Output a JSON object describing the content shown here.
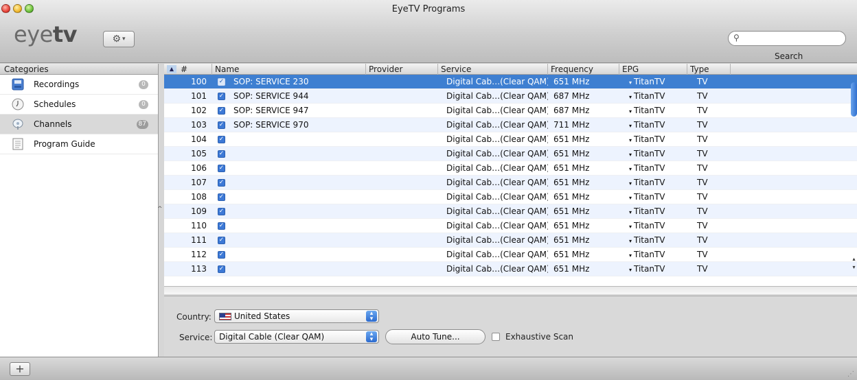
{
  "window": {
    "title": "EyeTV Programs"
  },
  "toolbar": {
    "logo_light": "eye",
    "logo_bold": "tv",
    "action_icon": "gear-icon",
    "search_placeholder": "",
    "search_label": "Search"
  },
  "sidebar": {
    "header": "Categories",
    "items": [
      {
        "label": "Recordings",
        "count": "0",
        "icon": "recordings-icon"
      },
      {
        "label": "Schedules",
        "count": "0",
        "icon": "clock-icon"
      },
      {
        "label": "Channels",
        "count": "87",
        "icon": "satellite-dish-icon"
      },
      {
        "label": "Program Guide",
        "count": "",
        "icon": "program-guide-icon"
      }
    ]
  },
  "table": {
    "columns": {
      "num": "#",
      "name": "Name",
      "provider": "Provider",
      "service": "Service",
      "frequency": "Frequency",
      "epg": "EPG",
      "type": "Type"
    },
    "rows": [
      {
        "num": "100",
        "name": "SOP: SERVICE 230",
        "provider": "",
        "service": "Digital Cab…(Clear QAM)",
        "frequency": "651 MHz",
        "epg": "TitanTV",
        "type": "TV"
      },
      {
        "num": "101",
        "name": "SOP: SERVICE 944",
        "provider": "",
        "service": "Digital Cab…(Clear QAM)",
        "frequency": "687 MHz",
        "epg": "TitanTV",
        "type": "TV"
      },
      {
        "num": "102",
        "name": "SOP: SERVICE 947",
        "provider": "",
        "service": "Digital Cab…(Clear QAM)",
        "frequency": "687 MHz",
        "epg": "TitanTV",
        "type": "TV"
      },
      {
        "num": "103",
        "name": "SOP: SERVICE 970",
        "provider": "",
        "service": "Digital Cab…(Clear QAM)",
        "frequency": "711 MHz",
        "epg": "TitanTV",
        "type": "TV"
      },
      {
        "num": "104",
        "name": "",
        "provider": "",
        "service": "Digital Cab…(Clear QAM)",
        "frequency": "651 MHz",
        "epg": "TitanTV",
        "type": "TV"
      },
      {
        "num": "105",
        "name": "",
        "provider": "",
        "service": "Digital Cab…(Clear QAM)",
        "frequency": "651 MHz",
        "epg": "TitanTV",
        "type": "TV"
      },
      {
        "num": "106",
        "name": "",
        "provider": "",
        "service": "Digital Cab…(Clear QAM)",
        "frequency": "651 MHz",
        "epg": "TitanTV",
        "type": "TV"
      },
      {
        "num": "107",
        "name": "",
        "provider": "",
        "service": "Digital Cab…(Clear QAM)",
        "frequency": "651 MHz",
        "epg": "TitanTV",
        "type": "TV"
      },
      {
        "num": "108",
        "name": "",
        "provider": "",
        "service": "Digital Cab…(Clear QAM)",
        "frequency": "651 MHz",
        "epg": "TitanTV",
        "type": "TV"
      },
      {
        "num": "109",
        "name": "",
        "provider": "",
        "service": "Digital Cab…(Clear QAM)",
        "frequency": "651 MHz",
        "epg": "TitanTV",
        "type": "TV"
      },
      {
        "num": "110",
        "name": "",
        "provider": "",
        "service": "Digital Cab…(Clear QAM)",
        "frequency": "651 MHz",
        "epg": "TitanTV",
        "type": "TV"
      },
      {
        "num": "111",
        "name": "",
        "provider": "",
        "service": "Digital Cab…(Clear QAM)",
        "frequency": "651 MHz",
        "epg": "TitanTV",
        "type": "TV"
      },
      {
        "num": "112",
        "name": "",
        "provider": "",
        "service": "Digital Cab…(Clear QAM)",
        "frequency": "651 MHz",
        "epg": "TitanTV",
        "type": "TV"
      },
      {
        "num": "113",
        "name": "",
        "provider": "",
        "service": "Digital Cab…(Clear QAM)",
        "frequency": "651 MHz",
        "epg": "TitanTV",
        "type": "TV"
      }
    ]
  },
  "options": {
    "country_label": "Country:",
    "country_value": "United States",
    "service_label": "Service:",
    "service_value": "Digital Cable (Clear QAM)",
    "auto_tune_label": "Auto Tune...",
    "exhaustive_scan_label": "Exhaustive Scan"
  },
  "bottombar": {
    "add_label": "+"
  },
  "colors": {
    "selection": "#3e7fd1",
    "checkbox": "#3d79d6",
    "stripe": "#edf3fe"
  }
}
